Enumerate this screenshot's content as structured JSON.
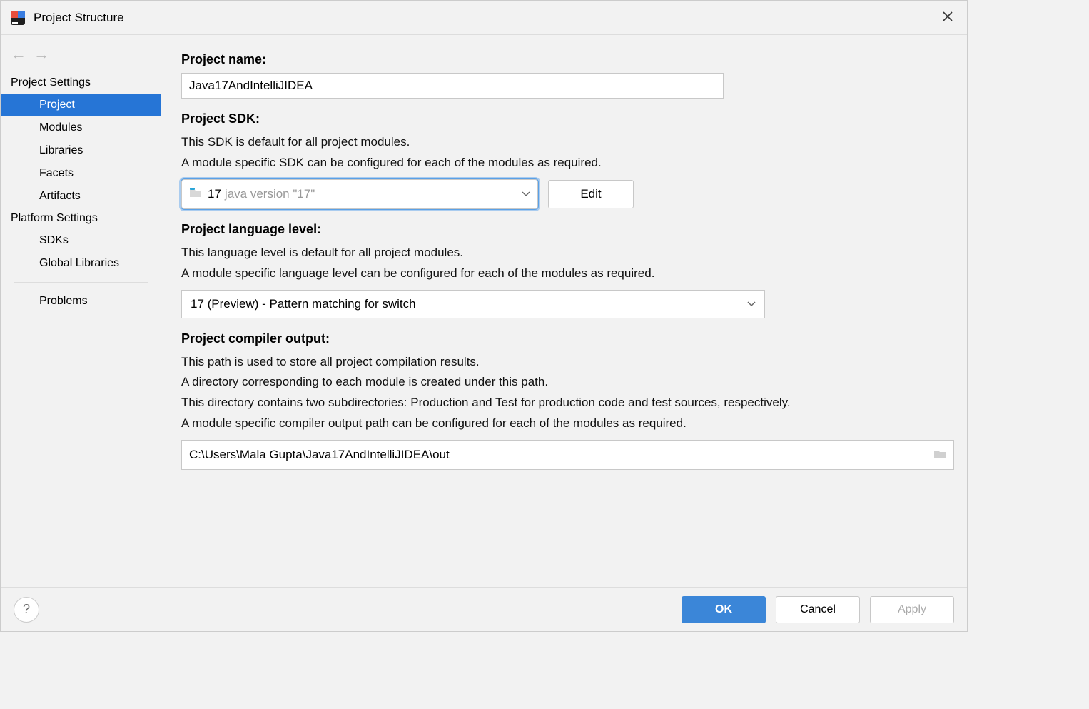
{
  "window": {
    "title": "Project Structure"
  },
  "sidebar": {
    "groups": [
      {
        "label": "Project Settings",
        "items": [
          {
            "label": "Project",
            "selected": true
          },
          {
            "label": "Modules"
          },
          {
            "label": "Libraries"
          },
          {
            "label": "Facets"
          },
          {
            "label": "Artifacts"
          }
        ]
      },
      {
        "label": "Platform Settings",
        "items": [
          {
            "label": "SDKs"
          },
          {
            "label": "Global Libraries"
          }
        ]
      }
    ],
    "bottom_items": [
      {
        "label": "Problems"
      }
    ]
  },
  "main": {
    "project_name": {
      "label": "Project name:",
      "value": "Java17AndIntelliJIDEA"
    },
    "project_sdk": {
      "label": "Project SDK:",
      "desc1": "This SDK is default for all project modules.",
      "desc2": "A module specific SDK can be configured for each of the modules as required.",
      "selected_name": "17",
      "selected_version": "java version \"17\"",
      "edit_label": "Edit"
    },
    "language_level": {
      "label": "Project language level:",
      "desc1": "This language level is default for all project modules.",
      "desc2": "A module specific language level can be configured for each of the modules as required.",
      "selected": "17 (Preview) - Pattern matching for switch"
    },
    "compiler_output": {
      "label": "Project compiler output:",
      "desc1": "This path is used to store all project compilation results.",
      "desc2": "A directory corresponding to each module is created under this path.",
      "desc3": "This directory contains two subdirectories: Production and Test for production code and test sources, respectively.",
      "desc4": "A module specific compiler output path can be configured for each of the modules as required.",
      "value": "C:\\Users\\Mala Gupta\\Java17AndIntelliJIDEA\\out"
    }
  },
  "footer": {
    "ok": "OK",
    "cancel": "Cancel",
    "apply": "Apply"
  }
}
